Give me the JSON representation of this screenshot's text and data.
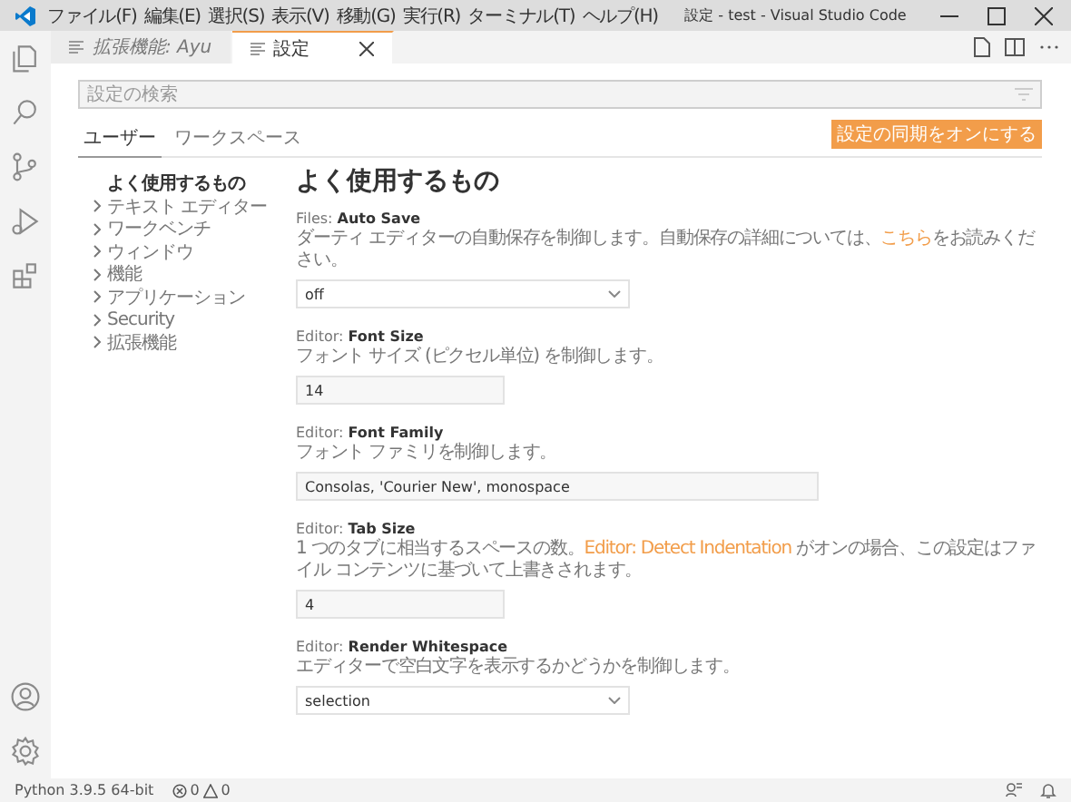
{
  "window": {
    "title": "設定 - test - Visual Studio Code"
  },
  "menu": [
    "ファイル(F)",
    "編集(E)",
    "選択(S)",
    "表示(V)",
    "移動(G)",
    "実行(R)",
    "ターミナル(T)",
    "ヘルプ(H)"
  ],
  "activity_bar": [
    {
      "kind": "files"
    },
    {
      "kind": "search"
    },
    {
      "kind": "scm"
    },
    {
      "kind": "debug"
    },
    {
      "kind": "extensions"
    }
  ],
  "editor_tabs": [
    {
      "label": "拡張機能: Ayu",
      "preview": true,
      "selected": false
    },
    {
      "label": "設定",
      "preview": false,
      "selected": true
    }
  ],
  "search": {
    "placeholder": "設定の検索"
  },
  "scope_tabs": [
    {
      "label": "ユーザー",
      "selected": true
    },
    {
      "label": "ワークスペース",
      "selected": false
    }
  ],
  "sync_button": "設定の同期をオンにする",
  "toc": [
    {
      "label": "よく使用するもの",
      "selected": true,
      "collapsible": false
    },
    {
      "label": "テキスト エディター",
      "selected": false,
      "collapsible": true
    },
    {
      "label": "ワークベンチ",
      "selected": false,
      "collapsible": true
    },
    {
      "label": "ウィンドウ",
      "selected": false,
      "collapsible": true
    },
    {
      "label": "機能",
      "selected": false,
      "collapsible": true
    },
    {
      "label": "アプリケーション",
      "selected": false,
      "collapsible": true
    },
    {
      "label": "Security",
      "selected": false,
      "collapsible": true
    },
    {
      "label": "拡張機能",
      "selected": false,
      "collapsible": true
    }
  ],
  "section_title": "よく使用するもの",
  "settings": [
    {
      "category": "Files: ",
      "name": "Auto Save",
      "description": [
        {
          "text": "ダーティ エディターの自動保存を制御します。自動保存の詳細については、"
        },
        {
          "text": "こちら",
          "kind": "link"
        },
        {
          "text": "をお読みください。"
        }
      ],
      "kind": "select",
      "value": "off"
    },
    {
      "category": "Editor: ",
      "name": "Font Size",
      "description": [
        {
          "text": "フォント サイズ (ピクセル単位) を制御します。"
        }
      ],
      "kind": "number",
      "value": "14"
    },
    {
      "category": "Editor: ",
      "name": "Font Family",
      "description": [
        {
          "text": "フォント ファミリを制御します。"
        }
      ],
      "kind": "text",
      "value": "Consolas, 'Courier New', monospace"
    },
    {
      "category": "Editor: ",
      "name": "Tab Size",
      "description": [
        {
          "text": "1 つのタブに相当するスペースの数。"
        },
        {
          "text": "Editor: Detect Indentation",
          "kind": "link"
        },
        {
          "text": " がオンの場合、この設定はファイル コンテンツに基づいて上書きされます。"
        }
      ],
      "kind": "number",
      "value": "4"
    },
    {
      "category": "Editor: ",
      "name": "Render Whitespace",
      "description": [
        {
          "text": "エディターで空白文字を表示するかどうかを制御します。"
        }
      ],
      "kind": "select",
      "value": "selection"
    }
  ],
  "status_bar": {
    "interpreter": "Python 3.9.5 64-bit",
    "errors": "0",
    "warnings": "0"
  }
}
